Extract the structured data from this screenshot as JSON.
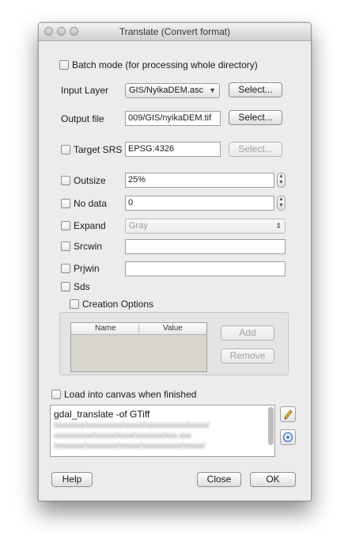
{
  "window": {
    "title": "Translate (Convert format)"
  },
  "batch_mode": {
    "label": "Batch mode (for processing whole directory)",
    "checked": false
  },
  "input_layer": {
    "label": "Input Layer",
    "value": "GIS/NyikaDEM.asc",
    "select_label": "Select..."
  },
  "output_file": {
    "label": "Output file",
    "value": "009/GIS/nyikaDEM.tif",
    "select_label": "Select..."
  },
  "target_srs": {
    "label": "Target SRS",
    "value": "EPSG:4326",
    "select_label": "Select...",
    "checked": false
  },
  "outsize": {
    "label": "Outsize",
    "value": "25%",
    "checked": false
  },
  "no_data": {
    "label": "No data",
    "value": "0",
    "checked": false
  },
  "expand": {
    "label": "Expand",
    "value": "Gray",
    "checked": false
  },
  "srcwin": {
    "label": "Srcwin",
    "value": "",
    "checked": false
  },
  "prjwin": {
    "label": "Prjwin",
    "value": "",
    "checked": false
  },
  "sds": {
    "label": "Sds",
    "checked": false
  },
  "creation_options": {
    "label": "Creation Options",
    "checked": false,
    "columns": [
      "Name",
      "Value"
    ],
    "add_label": "Add",
    "remove_label": "Remove"
  },
  "load_canvas": {
    "label": "Load into canvas when finished",
    "checked": false
  },
  "command": {
    "first_line": "gdal_translate -of GTiff"
  },
  "footer": {
    "help_label": "Help",
    "close_label": "Close",
    "ok_label": "OK"
  },
  "icons": {
    "edit": "pencil-icon",
    "info": "info-icon",
    "dropdown": "chevron-down-icon"
  },
  "colors": {
    "window_bg": "#ececec",
    "table_bg": "#d8d6cf"
  }
}
